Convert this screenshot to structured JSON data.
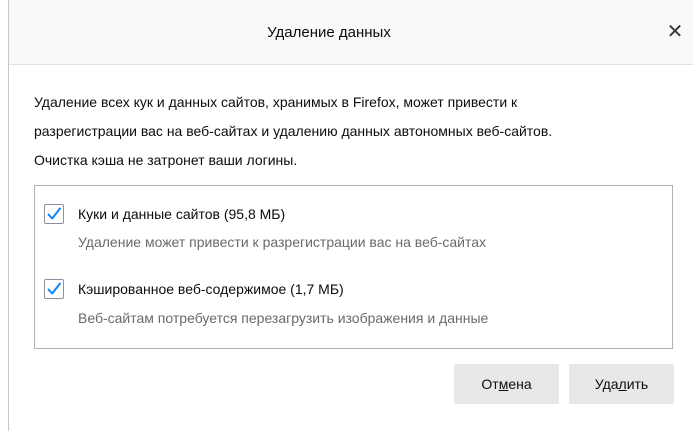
{
  "dialog": {
    "title": "Удаление данных",
    "close_glyph": "✕",
    "close_icon": "close-icon",
    "description": {
      "line1": "Удаление всех кук и данных сайтов, хранимых в Firefox, может привести к",
      "line2": "разрегистрации вас на веб-сайтах и удалению данных автономных веб-сайтов.",
      "line3": "Очистка кэша не затронет ваши логины."
    },
    "options": [
      {
        "checked": true,
        "label": "Куки и данные сайтов (95,8 МБ)",
        "sublabel": "Удаление может привести к разрегистрации вас на веб-сайтах"
      },
      {
        "checked": true,
        "label": "Кэшированное веб-содержимое (1,7 МБ)",
        "sublabel": "Веб-сайтам потребуется перезагрузить изображения и данные"
      }
    ],
    "buttons": {
      "cancel": {
        "pre": "От",
        "accesskey": "м",
        "post": "ена"
      },
      "delete": {
        "pre": "Уда",
        "accesskey": "л",
        "post": "ить"
      }
    },
    "colors": {
      "accent": "#0a84ff",
      "button_bg": "#e8e8e9",
      "titlebar_bg": "#f9f9fa"
    }
  }
}
